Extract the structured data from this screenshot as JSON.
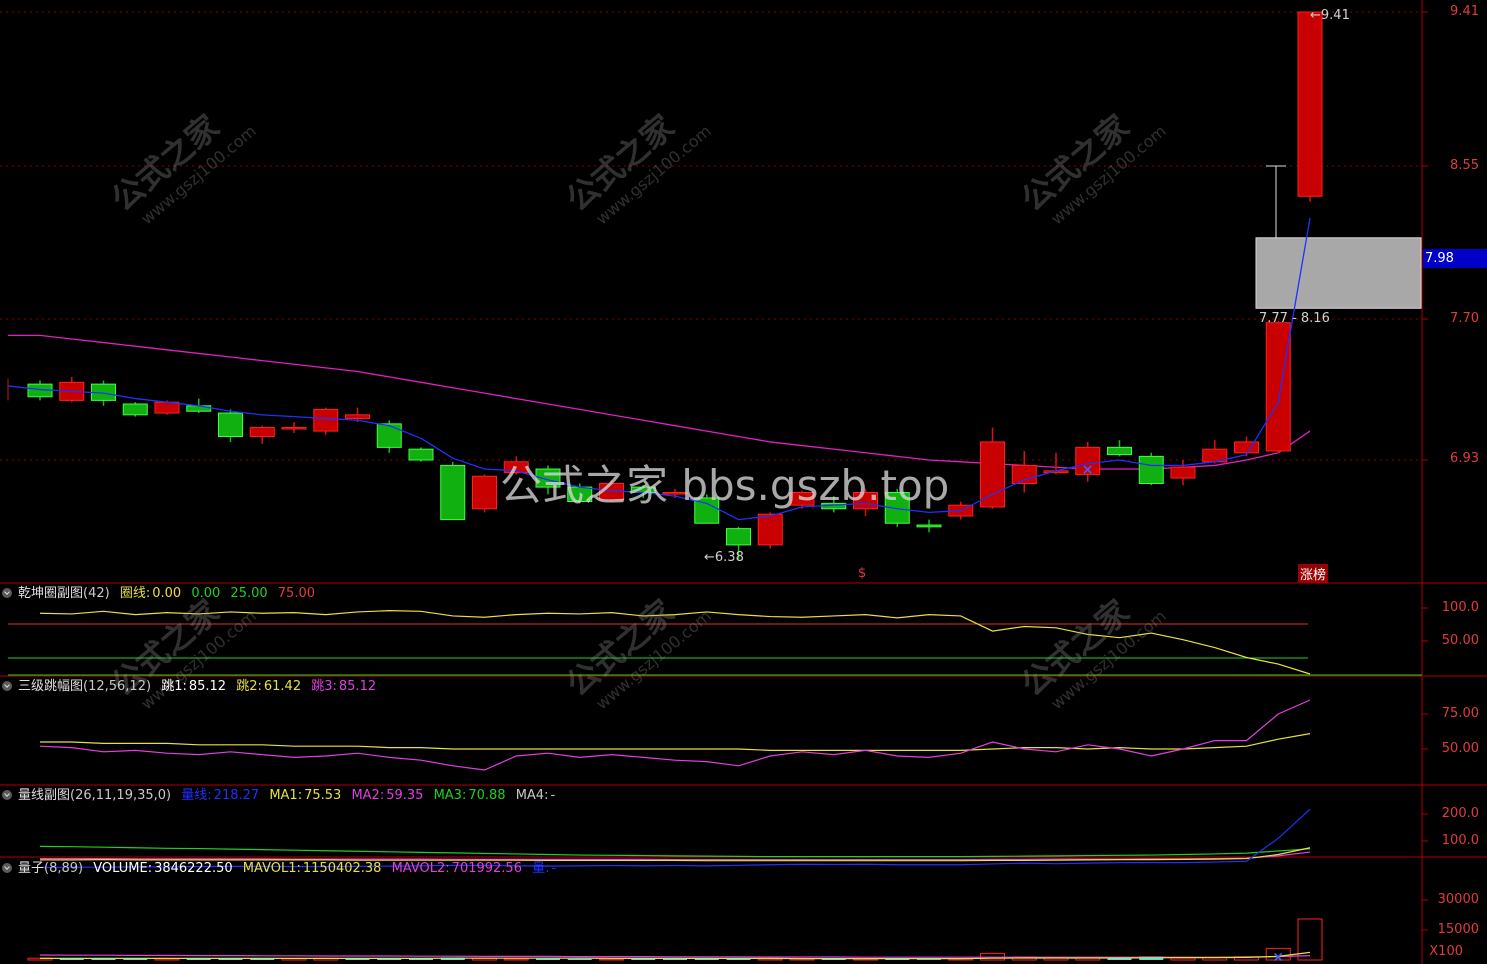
{
  "colors": {
    "up": "#e01010",
    "down": "#10c010",
    "ma_short": "#2030ff",
    "ma_long": "#e020c0",
    "grid": "#8a0000",
    "axis_text": "#e03c3c",
    "yellow": "#e8e040",
    "green": "#20d020",
    "magenta": "#e040e0",
    "cyan": "#40e8e8"
  },
  "main_panel": {
    "axis_labels": [
      "9.41",
      "8.55",
      "7.70",
      "6.93"
    ],
    "current_price": "7.98",
    "high_note": "9.41",
    "low_note": "6.38",
    "zone_label": "7.77 - 8.16",
    "signal_s": "$",
    "tag_zb": "涨榜",
    "center_watermark": "公式之家 bbs.gszb.top",
    "watermark_cn": "公式之家",
    "watermark_url": "www.gszj100.com"
  },
  "panel1": {
    "title": "乾坤圈副图",
    "params": "(42)",
    "items": [
      {
        "label": "圈线:",
        "value": "0.00",
        "color": "#e8e040"
      },
      {
        "label": "",
        "value": "0.00",
        "color": "#20d020"
      },
      {
        "label": "",
        "value": "25.00",
        "color": "#20d020"
      },
      {
        "label": "",
        "value": "75.00",
        "color": "#e03c3c"
      }
    ],
    "axis_labels": [
      "100.0",
      "50.00"
    ]
  },
  "panel2": {
    "title": "三级跳幅图",
    "params": "(12,56,12)",
    "items": [
      {
        "label": "跳1:",
        "value": "85.12",
        "color": "#ffffff"
      },
      {
        "label": "跳2:",
        "value": "61.42",
        "color": "#e8e040"
      },
      {
        "label": "跳3:",
        "value": "85.12",
        "color": "#e040e0"
      }
    ],
    "axis_labels": [
      "75.00",
      "50.00"
    ]
  },
  "panel3": {
    "title": "量线副图",
    "params": "(26,11,19,35,0)",
    "items": [
      {
        "label": "量线:",
        "value": "218.27",
        "color": "#2030ff"
      },
      {
        "label": "MA1:",
        "value": "75.53",
        "color": "#e8e040"
      },
      {
        "label": "MA2:",
        "value": "59.35",
        "color": "#e040e0"
      },
      {
        "label": "MA3:",
        "value": "70.88",
        "color": "#20d020"
      },
      {
        "label": "MA4:",
        "value": "-",
        "color": "#c8c8c8"
      }
    ],
    "axis_labels": [
      "200.0",
      "100.0"
    ]
  },
  "panel4": {
    "title": "量子",
    "params": "(8,89)",
    "items": [
      {
        "label": "VOLUME:",
        "value": "3846222.50",
        "color": "#ffffff"
      },
      {
        "label": "MAVOL1:",
        "value": "1150402.38",
        "color": "#e8e040"
      },
      {
        "label": "MAVOL2:",
        "value": "701992.56",
        "color": "#e040e0"
      },
      {
        "label": "量:",
        "value": "-",
        "color": "#2030ff"
      }
    ],
    "axis_labels": [
      "30000",
      "15000"
    ],
    "unit": "X100"
  },
  "candles": [
    {
      "o": 7.35,
      "c": 7.28,
      "h": 7.37,
      "l": 7.26
    },
    {
      "o": 7.26,
      "c": 7.36,
      "h": 7.39,
      "l": 7.25
    },
    {
      "o": 7.35,
      "c": 7.26,
      "h": 7.37,
      "l": 7.23
    },
    {
      "o": 7.24,
      "c": 7.18,
      "h": 7.25,
      "l": 7.17
    },
    {
      "o": 7.19,
      "c": 7.25,
      "h": 7.26,
      "l": 7.18
    },
    {
      "o": 7.23,
      "c": 7.2,
      "h": 7.27,
      "l": 7.19
    },
    {
      "o": 7.19,
      "c": 7.06,
      "h": 7.21,
      "l": 7.03
    },
    {
      "o": 7.06,
      "c": 7.11,
      "h": 7.12,
      "l": 7.02
    },
    {
      "o": 7.11,
      "c": 7.11,
      "h": 7.14,
      "l": 7.08
    },
    {
      "o": 7.09,
      "c": 7.21,
      "h": 7.22,
      "l": 7.07
    },
    {
      "o": 7.16,
      "c": 7.18,
      "h": 7.22,
      "l": 7.14
    },
    {
      "o": 7.13,
      "c": 7.0,
      "h": 7.15,
      "l": 6.97
    },
    {
      "o": 6.99,
      "c": 6.93,
      "h": 7.0,
      "l": 6.92
    },
    {
      "o": 6.9,
      "c": 6.6,
      "h": 6.92,
      "l": 6.6
    },
    {
      "o": 6.66,
      "c": 6.84,
      "h": 6.85,
      "l": 6.64
    },
    {
      "o": 6.86,
      "c": 6.92,
      "h": 6.95,
      "l": 6.85
    },
    {
      "o": 6.88,
      "c": 6.78,
      "h": 6.9,
      "l": 6.74
    },
    {
      "o": 6.78,
      "c": 6.7,
      "h": 6.8,
      "l": 6.69
    },
    {
      "o": 6.71,
      "c": 6.8,
      "h": 6.82,
      "l": 6.7
    },
    {
      "o": 6.78,
      "c": 6.75,
      "h": 6.79,
      "l": 6.72
    },
    {
      "o": 6.75,
      "c": 6.75,
      "h": 6.77,
      "l": 6.72
    },
    {
      "o": 6.72,
      "c": 6.58,
      "h": 6.74,
      "l": 6.58
    },
    {
      "o": 6.55,
      "c": 6.46,
      "h": 6.56,
      "l": 6.38
    },
    {
      "o": 6.46,
      "c": 6.63,
      "h": 6.64,
      "l": 6.44
    },
    {
      "o": 6.68,
      "c": 6.75,
      "h": 6.76,
      "l": 6.66
    },
    {
      "o": 6.69,
      "c": 6.66,
      "h": 6.73,
      "l": 6.64
    },
    {
      "o": 6.66,
      "c": 6.75,
      "h": 6.77,
      "l": 6.62
    },
    {
      "o": 6.75,
      "c": 6.58,
      "h": 6.77,
      "l": 6.56
    },
    {
      "o": 6.57,
      "c": 6.56,
      "h": 6.6,
      "l": 6.53
    },
    {
      "o": 6.62,
      "c": 6.68,
      "h": 6.7,
      "l": 6.6
    },
    {
      "o": 6.67,
      "c": 7.03,
      "h": 7.11,
      "l": 6.66
    },
    {
      "o": 6.8,
      "c": 6.9,
      "h": 6.98,
      "l": 6.75
    },
    {
      "o": 6.86,
      "c": 6.87,
      "h": 6.97,
      "l": 6.85
    },
    {
      "o": 6.85,
      "c": 7.0,
      "h": 7.03,
      "l": 6.81
    },
    {
      "o": 7.0,
      "c": 6.96,
      "h": 7.04,
      "l": 6.95
    },
    {
      "o": 6.95,
      "c": 6.8,
      "h": 6.97,
      "l": 6.79
    },
    {
      "o": 6.83,
      "c": 6.89,
      "h": 6.93,
      "l": 6.79
    },
    {
      "o": 6.92,
      "c": 6.99,
      "h": 7.04,
      "l": 6.91
    },
    {
      "o": 6.97,
      "c": 7.03,
      "h": 7.06,
      "l": 6.95
    },
    {
      "o": 6.98,
      "c": 7.69,
      "h": 7.7,
      "l": 6.97
    },
    {
      "o": 8.39,
      "c": 9.41,
      "h": 9.41,
      "l": 8.36
    }
  ],
  "ma_short": [
    7.32,
    7.31,
    7.3,
    7.27,
    7.25,
    7.23,
    7.2,
    7.18,
    7.17,
    7.16,
    7.15,
    7.12,
    7.05,
    6.94,
    6.88,
    6.87,
    6.82,
    6.78,
    6.76,
    6.75,
    6.73,
    6.69,
    6.6,
    6.62,
    6.67,
    6.68,
    6.69,
    6.66,
    6.64,
    6.65,
    6.74,
    6.82,
    6.87,
    6.91,
    6.93,
    6.9,
    6.9,
    6.92,
    6.96,
    7.25,
    8.27
  ],
  "ma_long": [
    7.62,
    7.6,
    7.58,
    7.56,
    7.54,
    7.52,
    7.5,
    7.48,
    7.46,
    7.44,
    7.42,
    7.39,
    7.36,
    7.33,
    7.3,
    7.27,
    7.24,
    7.21,
    7.18,
    7.15,
    7.12,
    7.09,
    7.06,
    7.03,
    7.01,
    6.99,
    6.97,
    6.95,
    6.93,
    6.92,
    6.91,
    6.9,
    6.89,
    6.88,
    6.88,
    6.88,
    6.89,
    6.9,
    6.93,
    6.97,
    7.09
  ],
  "zone": {
    "low": 7.77,
    "high": 8.16
  },
  "p1_yellow": [
    92,
    91,
    95,
    90,
    93,
    91,
    94,
    92,
    93,
    90,
    94,
    96,
    95,
    88,
    86,
    90,
    92,
    91,
    93,
    88,
    90,
    94,
    90,
    87,
    86,
    88,
    90,
    85,
    90,
    88,
    65,
    72,
    70,
    60,
    55,
    62,
    52,
    40,
    25,
    15,
    0
  ],
  "p2_yellow": [
    55,
    55,
    54,
    54,
    54,
    53,
    53,
    53,
    52,
    52,
    52,
    51,
    51,
    50,
    50,
    50,
    50,
    50,
    50,
    50,
    50,
    50,
    50,
    49,
    49,
    49,
    49,
    49,
    49,
    49,
    50,
    51,
    51,
    50,
    51,
    50,
    50,
    51,
    52,
    57,
    61
  ],
  "p2_magenta": [
    52,
    51,
    48,
    49,
    47,
    46,
    48,
    46,
    44,
    45,
    47,
    44,
    42,
    38,
    35,
    45,
    47,
    44,
    46,
    44,
    42,
    41,
    38,
    45,
    48,
    46,
    49,
    45,
    44,
    47,
    55,
    50,
    48,
    53,
    50,
    45,
    50,
    56,
    56,
    75,
    85
  ],
  "p3_blue": [
    2,
    3,
    3,
    4,
    4,
    5,
    6,
    6,
    5,
    5,
    6,
    7,
    8,
    10,
    9,
    8,
    7,
    8,
    9,
    8,
    9,
    8,
    10,
    12,
    14,
    13,
    14,
    12,
    12,
    12,
    15,
    18,
    16,
    18,
    20,
    20,
    20,
    22,
    25,
    110,
    218
  ],
  "p3_yellow": [
    30,
    30,
    31,
    30,
    30,
    30,
    30,
    30,
    30,
    30,
    29,
    29,
    29,
    29,
    29,
    29,
    28,
    28,
    28,
    28,
    28,
    27,
    27,
    27,
    27,
    27,
    27,
    27,
    27,
    27,
    28,
    28,
    29,
    30,
    31,
    31,
    32,
    33,
    35,
    50,
    75
  ],
  "p3_magenta": [
    35,
    35,
    35,
    34,
    34,
    34,
    34,
    34,
    33,
    33,
    33,
    33,
    33,
    32,
    32,
    32,
    32,
    32,
    32,
    32,
    31,
    31,
    31,
    31,
    31,
    31,
    31,
    31,
    31,
    31,
    32,
    32,
    33,
    33,
    33,
    34,
    34,
    35,
    36,
    45,
    59
  ],
  "p3_green": [
    80,
    79,
    77,
    75,
    73,
    72,
    70,
    68,
    66,
    64,
    62,
    60,
    58,
    56,
    54,
    52,
    50,
    48,
    47,
    46,
    45,
    44,
    43,
    42,
    42,
    42,
    42,
    42,
    42,
    42,
    43,
    44,
    45,
    46,
    47,
    48,
    50,
    52,
    55,
    63,
    71
  ],
  "volume": [
    9,
    8,
    7,
    8,
    6,
    7,
    8,
    7,
    7,
    8,
    9,
    9,
    10,
    12,
    8,
    6,
    7,
    6,
    5,
    5,
    6,
    7,
    8,
    6,
    6,
    7,
    5,
    5,
    4,
    6,
    33,
    15,
    10,
    12,
    14,
    18,
    10,
    12,
    16,
    58,
    205
  ],
  "volume_flags": [
    "u",
    "d",
    "d",
    "d",
    "u",
    "d",
    "d",
    "d",
    "u",
    "u",
    "d",
    "d",
    "d",
    "d",
    "u",
    "u",
    "d",
    "d",
    "u",
    "d",
    "d",
    "d",
    "d",
    "u",
    "u",
    "d",
    "u",
    "d",
    "d",
    "u",
    "u",
    "u",
    "u",
    "u",
    "d",
    "d",
    "u",
    "u",
    "u",
    "u",
    "u"
  ],
  "mavol1": [
    8,
    8,
    8,
    8,
    8,
    8,
    8,
    8,
    8,
    8,
    8,
    8,
    8,
    9,
    9,
    9,
    9,
    9,
    8,
    8,
    8,
    8,
    8,
    8,
    7,
    7,
    7,
    7,
    7,
    7,
    9,
    10,
    10,
    10,
    10,
    11,
    12,
    12,
    13,
    18,
    38
  ],
  "mavol2": [
    25,
    24,
    24,
    23,
    23,
    22,
    22,
    21,
    21,
    20,
    20,
    20,
    19,
    19,
    18,
    18,
    18,
    17,
    17,
    17,
    16,
    16,
    16,
    15,
    15,
    15,
    14,
    14,
    14,
    14,
    14,
    14,
    14,
    14,
    14,
    14,
    14,
    14,
    15,
    17,
    22
  ]
}
